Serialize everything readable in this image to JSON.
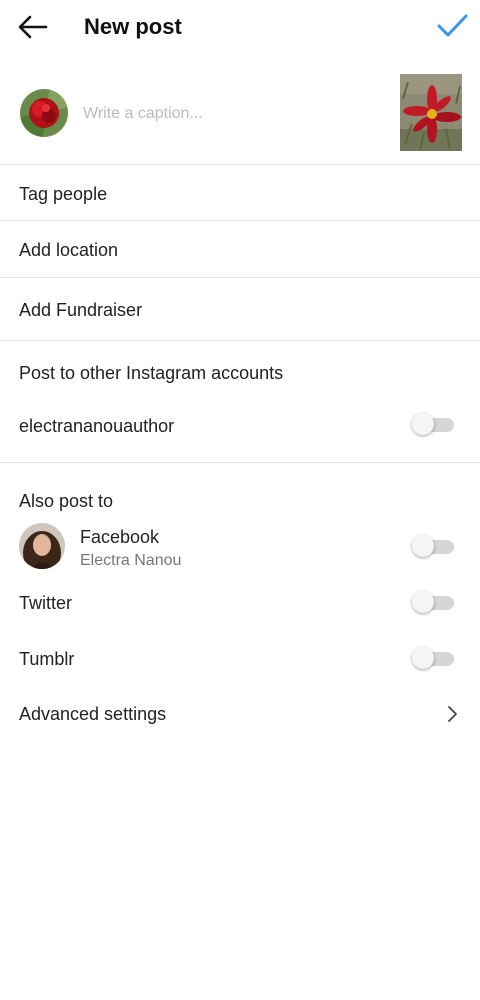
{
  "header": {
    "title": "New post"
  },
  "composer": {
    "caption_placeholder": "Write a caption..."
  },
  "rows": {
    "tag_people": "Tag people",
    "add_location": "Add location",
    "add_fundraiser": "Add Fundraiser"
  },
  "other_accounts": {
    "heading": "Post to other Instagram accounts",
    "account_name": "electrananouauthor",
    "account_enabled": false
  },
  "also_post": {
    "heading": "Also post to",
    "facebook": {
      "label": "Facebook",
      "name": "Electra Nanou",
      "enabled": false
    },
    "twitter": {
      "label": "Twitter",
      "enabled": false
    },
    "tumblr": {
      "label": "Tumblr",
      "enabled": false
    }
  },
  "advanced": {
    "label": "Advanced settings"
  },
  "colors": {
    "accent": "#3797f0",
    "divider": "#e4e4e4",
    "toggle_track": "#d6d6d6"
  }
}
